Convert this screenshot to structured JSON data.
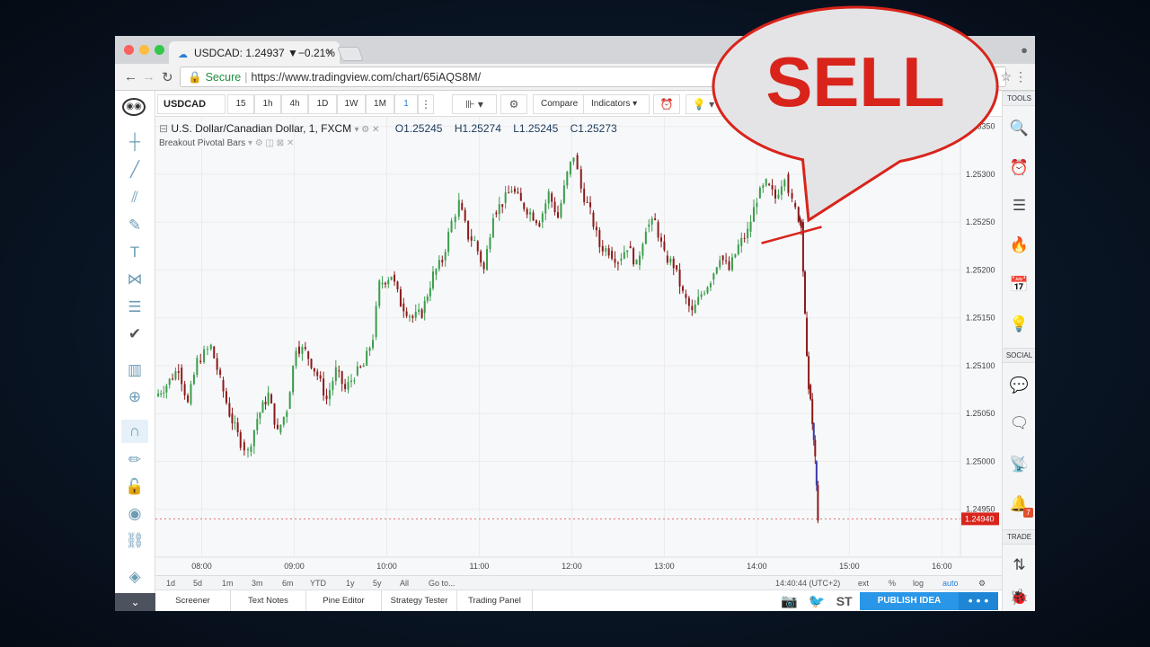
{
  "browser": {
    "tab_title": "USDCAD: 1.24937 ▼−0.21%",
    "tab_close": "×",
    "secure_label": "Secure",
    "url": "https://www.tradingview.com/chart/65iAQS8M/",
    "traffic_colors": [
      "#fc605c",
      "#fdbc40",
      "#34c84a"
    ]
  },
  "toolbar": {
    "symbol": "USDCAD",
    "intervals": [
      "15",
      "1h",
      "4h",
      "1D",
      "1W",
      "1M",
      "1"
    ],
    "selected_interval": "1",
    "compare_label": "Compare",
    "indicators_label": "Indicators"
  },
  "legend": {
    "title": "U.S. Dollar/Canadian Dollar, 1, FXCM",
    "open": "O1.25245",
    "high": "H1.25274",
    "low": "L1.25245",
    "close": "C1.25273",
    "indicator": "Breakout Pivotal Bars"
  },
  "callout": {
    "text": "SELL",
    "color": "#d8241b"
  },
  "chart_data": {
    "type": "candlestick",
    "symbol": "USDCAD",
    "y_ticks": [
      "1.25350",
      "1.25300",
      "1.25250",
      "1.25200",
      "1.25150",
      "1.25100",
      "1.25050",
      "1.25000",
      "1.24950"
    ],
    "x_ticks": [
      "08:00",
      "09:00",
      "10:00",
      "11:00",
      "12:00",
      "13:00",
      "14:00",
      "15:00",
      "16:00"
    ],
    "ylim": [
      1.249,
      1.2536
    ],
    "last_price": "1.24940",
    "up_color": "#3a9d4a",
    "down_color": "#8b1a1a",
    "breakout_color": "#3b3baa",
    "price_path": [
      [
        7.5,
        1.25068
      ],
      [
        7.62,
        1.2508
      ],
      [
        7.75,
        1.25098
      ],
      [
        7.85,
        1.2506
      ],
      [
        7.95,
        1.25105
      ],
      [
        8.1,
        1.2512
      ],
      [
        8.2,
        1.25085
      ],
      [
        8.3,
        1.2505
      ],
      [
        8.42,
        1.2502
      ],
      [
        8.5,
        1.2501
      ],
      [
        8.6,
        1.25045
      ],
      [
        8.72,
        1.2507
      ],
      [
        8.82,
        1.2503
      ],
      [
        8.92,
        1.25055
      ],
      [
        9.02,
        1.2512
      ],
      [
        9.12,
        1.25115
      ],
      [
        9.25,
        1.2509
      ],
      [
        9.35,
        1.25065
      ],
      [
        9.45,
        1.25095
      ],
      [
        9.55,
        1.25075
      ],
      [
        9.65,
        1.2509
      ],
      [
        9.75,
        1.251
      ],
      [
        9.85,
        1.2513
      ],
      [
        9.92,
        1.25185
      ],
      [
        10.05,
        1.25195
      ],
      [
        10.15,
        1.25165
      ],
      [
        10.28,
        1.2515
      ],
      [
        10.38,
        1.25155
      ],
      [
        10.5,
        1.25195
      ],
      [
        10.6,
        1.2521
      ],
      [
        10.7,
        1.2525
      ],
      [
        10.78,
        1.2527
      ],
      [
        10.88,
        1.25235
      ],
      [
        10.95,
        1.2523
      ],
      [
        11.05,
        1.252
      ],
      [
        11.15,
        1.2526
      ],
      [
        11.25,
        1.2527
      ],
      [
        11.35,
        1.25285
      ],
      [
        11.45,
        1.2527
      ],
      [
        11.55,
        1.2526
      ],
      [
        11.65,
        1.2525
      ],
      [
        11.75,
        1.2528
      ],
      [
        11.85,
        1.25255
      ],
      [
        11.95,
        1.253
      ],
      [
        12.02,
        1.2532
      ],
      [
        12.1,
        1.25285
      ],
      [
        12.2,
        1.2526
      ],
      [
        12.3,
        1.25225
      ],
      [
        12.4,
        1.2522
      ],
      [
        12.5,
        1.2521
      ],
      [
        12.6,
        1.25225
      ],
      [
        12.7,
        1.25205
      ],
      [
        12.8,
        1.25245
      ],
      [
        12.9,
        1.2525
      ],
      [
        13.0,
        1.25215
      ],
      [
        13.1,
        1.25205
      ],
      [
        13.2,
        1.25175
      ],
      [
        13.3,
        1.25155
      ],
      [
        13.4,
        1.25175
      ],
      [
        13.5,
        1.2519
      ],
      [
        13.6,
        1.25215
      ],
      [
        13.7,
        1.252
      ],
      [
        13.8,
        1.25225
      ],
      [
        13.9,
        1.2524
      ],
      [
        14.0,
        1.25275
      ],
      [
        14.1,
        1.2529
      ],
      [
        14.2,
        1.25275
      ],
      [
        14.3,
        1.253
      ],
      [
        14.38,
        1.2527
      ],
      [
        14.45,
        1.25255
      ],
      [
        14.48,
        1.2525
      ],
      [
        14.52,
        1.2515
      ],
      [
        14.56,
        1.2508
      ],
      [
        14.6,
        1.2504
      ],
      [
        14.63,
        1.25
      ],
      [
        14.66,
        1.2494
      ]
    ],
    "trendline": [
      [
        14.05,
        1.25228
      ],
      [
        14.7,
        1.25245
      ]
    ]
  },
  "time_axis": {
    "ranges": [
      "1d",
      "5d",
      "1m",
      "3m",
      "6m",
      "YTD",
      "1y",
      "5y",
      "All",
      "Go to..."
    ],
    "clock": "14:40:44 (UTC+2)",
    "options": [
      "ext",
      "%",
      "log",
      "auto"
    ]
  },
  "panels": [
    "Screener",
    "Text Notes",
    "Pine Editor",
    "Strategy Tester",
    "Trading Panel"
  ],
  "publish_label": "PUBLISH IDEA",
  "publish_more": "• • •",
  "bottom_st": "ST",
  "rightbar": {
    "tools_label": "TOOLS",
    "social_label": "SOCIAL",
    "trade_label": "TRADE",
    "notification_count": "7"
  }
}
